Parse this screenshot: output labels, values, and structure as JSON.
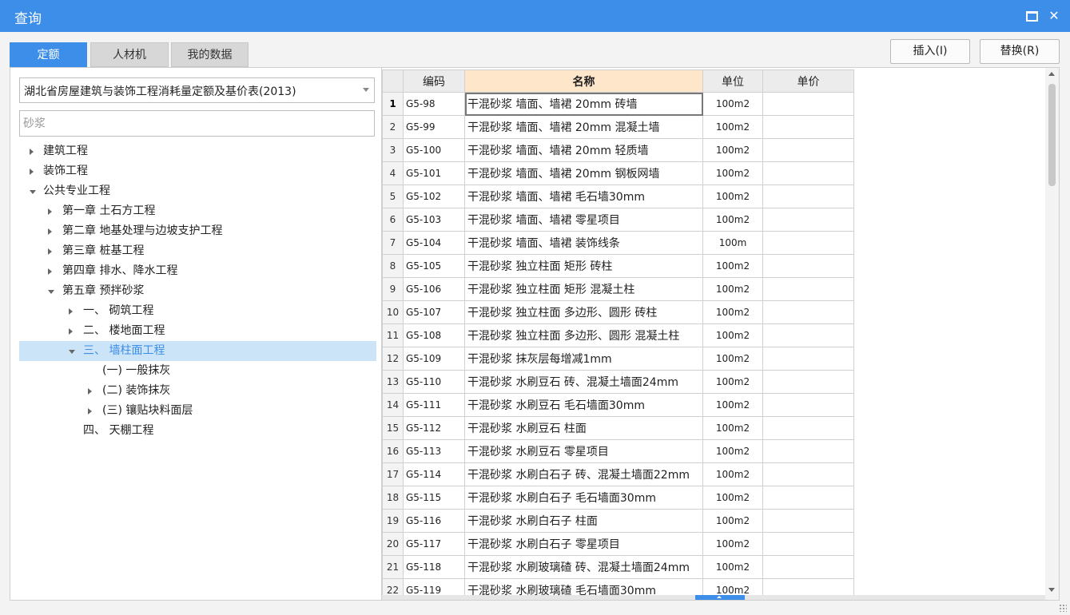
{
  "window": {
    "title": "查询"
  },
  "tabs": [
    {
      "label": "定额",
      "active": true
    },
    {
      "label": "人材机",
      "active": false
    },
    {
      "label": "我的数据",
      "active": false
    }
  ],
  "actions": {
    "insert_label": "插入(I)",
    "replace_label": "替换(R)"
  },
  "library": {
    "selected": "湖北省房屋建筑与装饰工程消耗量定额及基价表(2013)"
  },
  "search": {
    "placeholder": "砂浆",
    "value": ""
  },
  "tree": [
    {
      "label": "建筑工程",
      "level": 0,
      "state": "collapsed"
    },
    {
      "label": "装饰工程",
      "level": 0,
      "state": "collapsed"
    },
    {
      "label": "公共专业工程",
      "level": 0,
      "state": "expanded"
    },
    {
      "label": "第一章 土石方工程",
      "level": 1,
      "state": "collapsed"
    },
    {
      "label": "第二章 地基处理与边坡支护工程",
      "level": 1,
      "state": "collapsed"
    },
    {
      "label": "第三章 桩基工程",
      "level": 1,
      "state": "collapsed"
    },
    {
      "label": "第四章 排水、降水工程",
      "level": 1,
      "state": "collapsed"
    },
    {
      "label": "第五章 预拌砂浆",
      "level": 1,
      "state": "expanded"
    },
    {
      "label": "一、 砌筑工程",
      "level": 2,
      "state": "collapsed"
    },
    {
      "label": "二、 楼地面工程",
      "level": 2,
      "state": "collapsed"
    },
    {
      "label": "三、 墙柱面工程",
      "level": 2,
      "state": "expanded",
      "selected": true
    },
    {
      "label": "(一) 一般抹灰",
      "level": 3,
      "state": "leaf"
    },
    {
      "label": "(二) 装饰抹灰",
      "level": 3,
      "state": "collapsed"
    },
    {
      "label": "(三) 镶贴块料面层",
      "level": 3,
      "state": "collapsed"
    },
    {
      "label": "四、 天棚工程",
      "level": 2,
      "state": "leaf"
    }
  ],
  "grid": {
    "columns": [
      "",
      "编码",
      "名称",
      "单位",
      "单价"
    ],
    "rows": [
      {
        "n": "1",
        "code": "G5-98",
        "name": "干混砂浆 墙面、墙裙 20mm 砖墙",
        "unit": "100m2",
        "price": ""
      },
      {
        "n": "2",
        "code": "G5-99",
        "name": "干混砂浆 墙面、墙裙 20mm 混凝土墙",
        "unit": "100m2",
        "price": ""
      },
      {
        "n": "3",
        "code": "G5-100",
        "name": "干混砂浆 墙面、墙裙 20mm 轻质墙",
        "unit": "100m2",
        "price": ""
      },
      {
        "n": "4",
        "code": "G5-101",
        "name": "干混砂浆 墙面、墙裙 20mm 钢板网墙",
        "unit": "100m2",
        "price": ""
      },
      {
        "n": "5",
        "code": "G5-102",
        "name": "干混砂浆 墙面、墙裙 毛石墙30mm",
        "unit": "100m2",
        "price": ""
      },
      {
        "n": "6",
        "code": "G5-103",
        "name": "干混砂浆 墙面、墙裙 零星项目",
        "unit": "100m2",
        "price": ""
      },
      {
        "n": "7",
        "code": "G5-104",
        "name": "干混砂浆 墙面、墙裙 装饰线条",
        "unit": "100m",
        "price": ""
      },
      {
        "n": "8",
        "code": "G5-105",
        "name": "干混砂浆 独立柱面 矩形 砖柱",
        "unit": "100m2",
        "price": ""
      },
      {
        "n": "9",
        "code": "G5-106",
        "name": "干混砂浆 独立柱面 矩形 混凝土柱",
        "unit": "100m2",
        "price": ""
      },
      {
        "n": "10",
        "code": "G5-107",
        "name": "干混砂浆 独立柱面 多边形、圆形 砖柱",
        "unit": "100m2",
        "price": ""
      },
      {
        "n": "11",
        "code": "G5-108",
        "name": "干混砂浆 独立柱面 多边形、圆形 混凝土柱",
        "unit": "100m2",
        "price": ""
      },
      {
        "n": "12",
        "code": "G5-109",
        "name": "干混砂浆 抹灰层每增减1mm",
        "unit": "100m2",
        "price": ""
      },
      {
        "n": "13",
        "code": "G5-110",
        "name": "干混砂浆 水刷豆石 砖、混凝土墙面24mm",
        "unit": "100m2",
        "price": ""
      },
      {
        "n": "14",
        "code": "G5-111",
        "name": "干混砂浆 水刷豆石 毛石墙面30mm",
        "unit": "100m2",
        "price": ""
      },
      {
        "n": "15",
        "code": "G5-112",
        "name": "干混砂浆 水刷豆石 柱面",
        "unit": "100m2",
        "price": ""
      },
      {
        "n": "16",
        "code": "G5-113",
        "name": "干混砂浆 水刷豆石 零星项目",
        "unit": "100m2",
        "price": ""
      },
      {
        "n": "17",
        "code": "G5-114",
        "name": "干混砂浆 水刷白石子 砖、混凝土墙面22mm",
        "unit": "100m2",
        "price": ""
      },
      {
        "n": "18",
        "code": "G5-115",
        "name": "干混砂浆 水刷白石子 毛石墙面30mm",
        "unit": "100m2",
        "price": ""
      },
      {
        "n": "19",
        "code": "G5-116",
        "name": "干混砂浆 水刷白石子 柱面",
        "unit": "100m2",
        "price": ""
      },
      {
        "n": "20",
        "code": "G5-117",
        "name": "干混砂浆 水刷白石子 零星项目",
        "unit": "100m2",
        "price": ""
      },
      {
        "n": "21",
        "code": "G5-118",
        "name": "干混砂浆 水刷玻璃碴 砖、混凝土墙面24mm",
        "unit": "100m2",
        "price": ""
      },
      {
        "n": "22",
        "code": "G5-119",
        "name": "干混砂浆 水刷玻璃碴 毛石墙面30mm",
        "unit": "100m2",
        "price": ""
      }
    ]
  },
  "colors": {
    "accent": "#3d8ee8",
    "selection": "#cce4f7",
    "header_highlight": "#fde6c9"
  }
}
